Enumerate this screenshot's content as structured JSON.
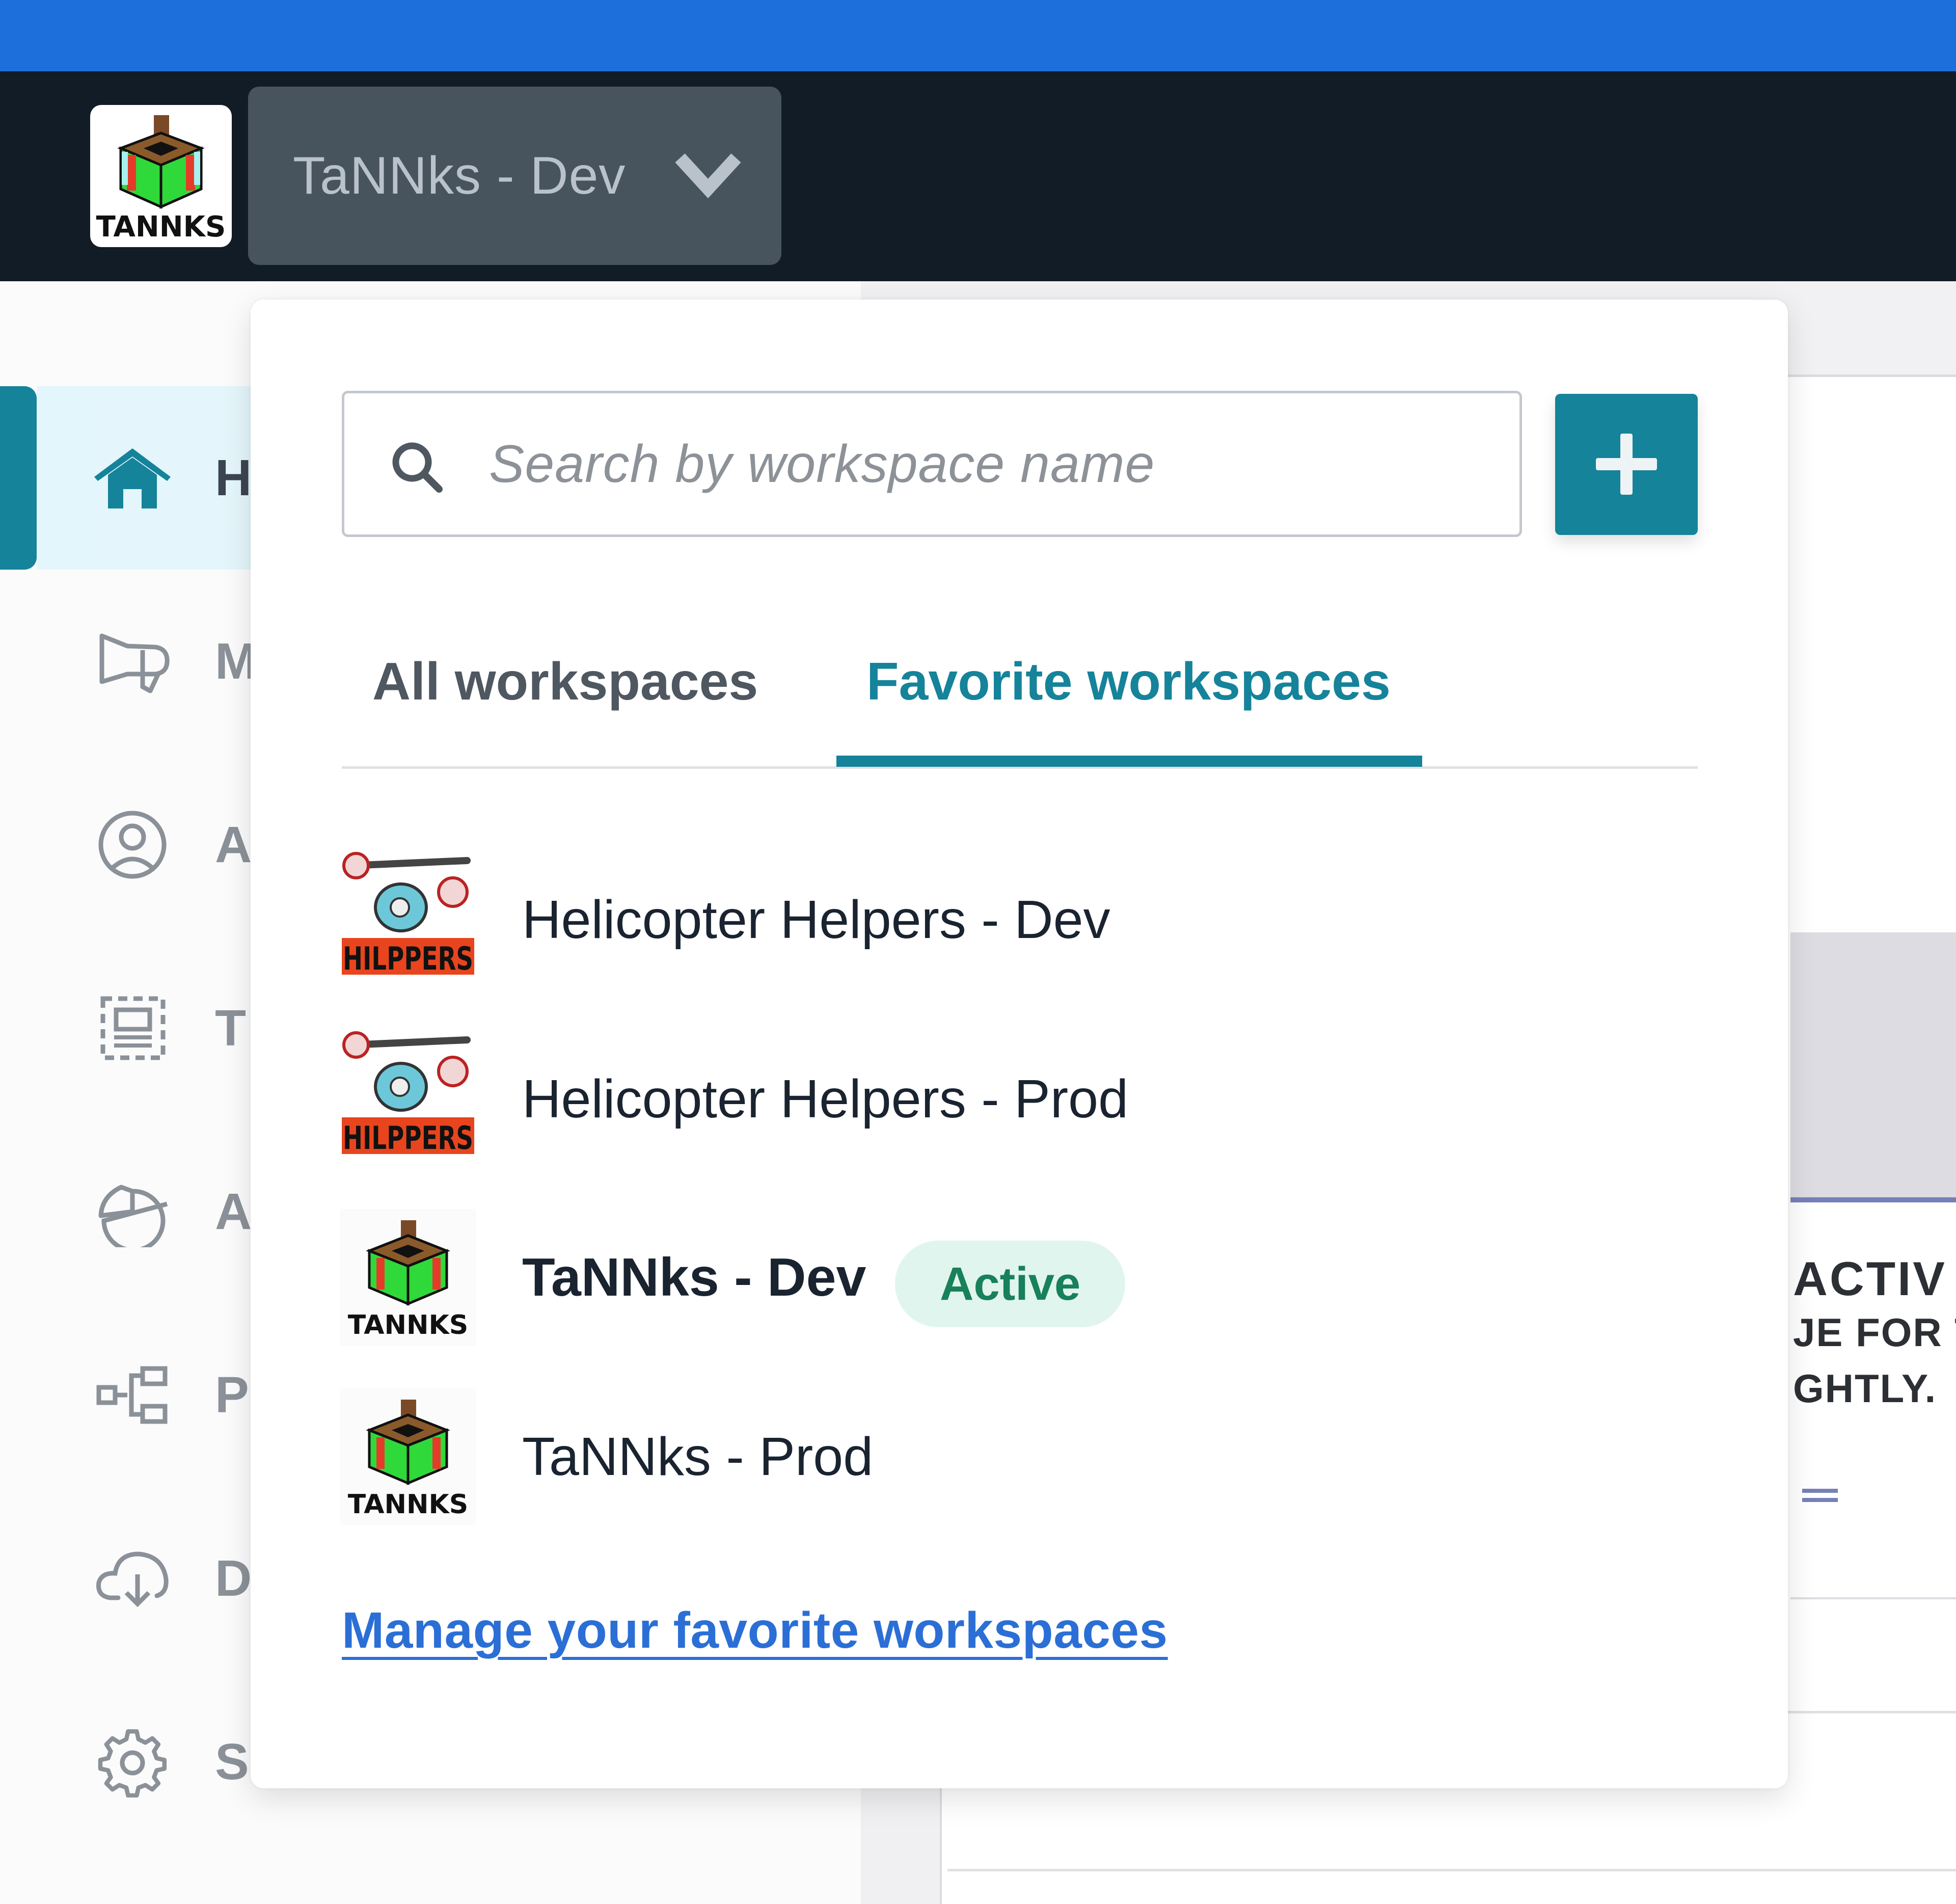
{
  "header": {
    "logo_text": "TANNKS",
    "workspace_selector": {
      "label": "TaNNks - Dev",
      "icon": "chevron-down-icon"
    }
  },
  "sidebar": {
    "items": [
      {
        "label": "H",
        "icon": "home-icon",
        "active": true
      },
      {
        "label": "M",
        "icon": "megaphone-icon",
        "active": false
      },
      {
        "label": "A",
        "icon": "user-circle-icon",
        "active": false
      },
      {
        "label": "T",
        "icon": "template-icon",
        "active": false
      },
      {
        "label": "A",
        "icon": "pie-chart-icon",
        "active": false
      },
      {
        "label": "P",
        "icon": "pipeline-icon",
        "active": false
      },
      {
        "label": "D",
        "icon": "cloud-download-icon",
        "active": false
      },
      {
        "label": "S",
        "icon": "gear-icon",
        "active": false
      }
    ]
  },
  "main": {
    "card_heading": "ACTIV",
    "card_line_1": "JE FOR T",
    "card_line_2": "GHTLY."
  },
  "dropdown": {
    "search": {
      "placeholder": "Search by workspace name",
      "value": ""
    },
    "add_button_label": "+",
    "tabs": [
      {
        "label": "All workspaces",
        "selected": false
      },
      {
        "label": "Favorite workspaces",
        "selected": true
      }
    ],
    "workspaces": [
      {
        "name": "Helicopter Helpers - Dev",
        "logo": "hilppers-logo",
        "logo_text": "HILPPERS",
        "active": false
      },
      {
        "name": "Helicopter Helpers - Prod",
        "logo": "hilppers-logo",
        "logo_text": "HILPPERS",
        "active": false
      },
      {
        "name": "TaNNks - Dev",
        "logo": "tannks-logo",
        "logo_text": "TANNKS",
        "active": true,
        "badge": "Active"
      },
      {
        "name": "TaNNks - Prod",
        "logo": "tannks-logo",
        "logo_text": "TANNKS",
        "active": false
      }
    ],
    "manage_link": "Manage your favorite workspaces"
  },
  "colors": {
    "top_bar": "#1d6fdc",
    "nav_bar": "#121c26",
    "accent": "#15839a",
    "link": "#2b6fd6",
    "active_badge_bg": "#e0f5ee",
    "active_badge_text": "#18805a"
  }
}
